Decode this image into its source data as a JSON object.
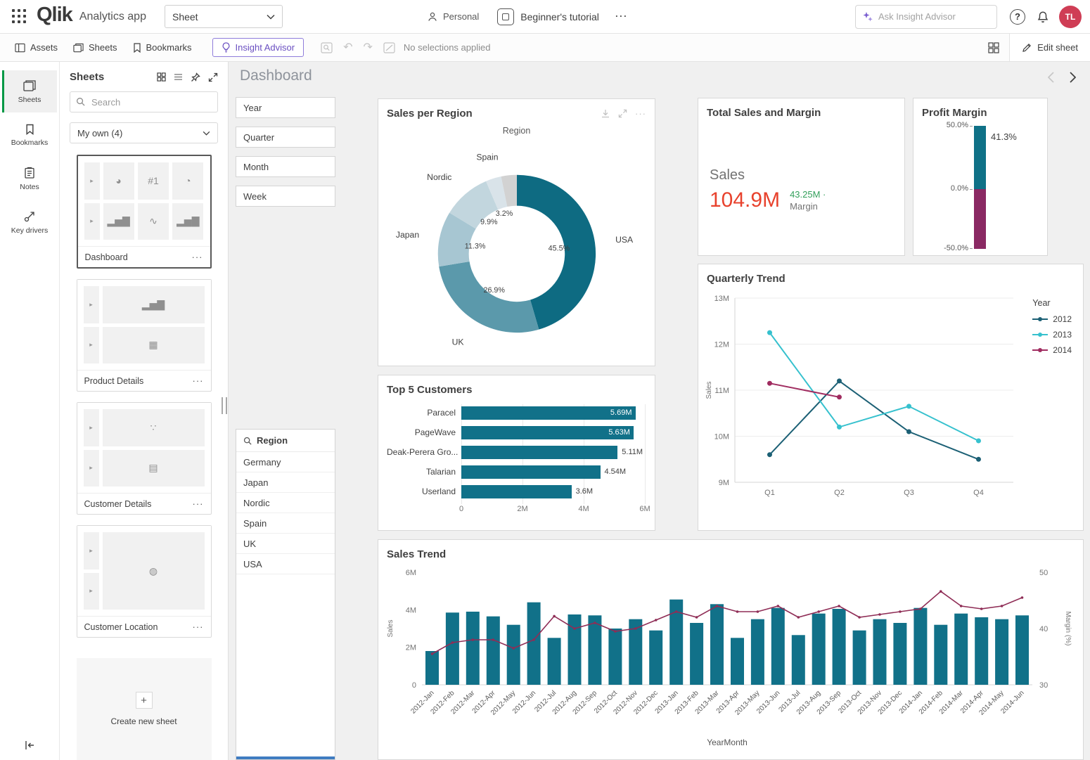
{
  "header": {
    "logo": "Qlik",
    "app_name": "Analytics app",
    "sheet_selector": "Sheet",
    "space": "Personal",
    "app_title": "Beginner's tutorial",
    "ask_placeholder": "Ask Insight Advisor",
    "avatar_initials": "TL"
  },
  "icons": {
    "more_h": "⋯",
    "more_v": "···",
    "help": "?",
    "plus": "+",
    "undo": "↶",
    "redo": "↷"
  },
  "toolbar": {
    "assets": "Assets",
    "sheets": "Sheets",
    "bookmarks": "Bookmarks",
    "insight_advisor": "Insight Advisor",
    "selections_status": "No selections applied",
    "edit_sheet": "Edit sheet"
  },
  "nav_rail": {
    "items": [
      {
        "label": "Sheets",
        "icon": "sheets",
        "active": true
      },
      {
        "label": "Bookmarks",
        "icon": "bookmark",
        "active": false
      },
      {
        "label": "Notes",
        "icon": "notes",
        "active": false
      },
      {
        "label": "Key drivers",
        "icon": "keydrivers",
        "active": false
      }
    ]
  },
  "sheets_panel": {
    "title": "Sheets",
    "search_placeholder": "Search",
    "collection": "My own (4)",
    "sheets": [
      {
        "label": "Dashboard",
        "active": true,
        "cols": 3,
        "tiles": [
          "pie",
          "rank",
          "gauge",
          "bar",
          "line",
          "bar"
        ]
      },
      {
        "label": "Product Details",
        "active": false,
        "cols": 1,
        "tiles": [
          "bar",
          "treemap"
        ]
      },
      {
        "label": "Customer Details",
        "active": false,
        "cols": 1,
        "tiles": [
          "scatter",
          "table"
        ]
      },
      {
        "label": "Customer Location",
        "active": false,
        "cols": 1,
        "tiles": [
          "globe"
        ]
      }
    ],
    "create_new": "Create new sheet"
  },
  "canvas": {
    "title": "Dashboard",
    "filters": [
      "Year",
      "Quarter",
      "Month",
      "Week"
    ],
    "region_filter": {
      "title": "Region",
      "values": [
        "Germany",
        "Japan",
        "Nordic",
        "Spain",
        "UK",
        "USA"
      ]
    }
  },
  "colors": {
    "accent_green": "#009845",
    "insight_purple": "#6a4fc1",
    "avatar_bg": "#cf3d55",
    "kpi_red": "#e8422d",
    "kpi_green": "#34a05c",
    "bar_teal": "#117189",
    "scroll_indicator_blue": "#3f7cc1"
  },
  "chart_data": [
    {
      "id": "sales_per_region",
      "type": "pie",
      "title": "Sales per Region",
      "dimension_label": "Region",
      "slices": [
        {
          "label": "USA",
          "pct": 45.5,
          "color": "#0e6b82"
        },
        {
          "label": "UK",
          "pct": 26.9,
          "color": "#5b99ab"
        },
        {
          "label": "Japan",
          "pct": 11.3,
          "color": "#a7c6d2"
        },
        {
          "label": "Nordic",
          "pct": 9.9,
          "color": "#c2d6de"
        },
        {
          "label": "Spain",
          "pct": 3.2,
          "color": "#d9e3e9"
        },
        {
          "label": "",
          "pct": 3.2,
          "color": "#d2d2d2"
        }
      ]
    },
    {
      "id": "total_sales_margin",
      "type": "kpi",
      "title": "Total Sales and Margin",
      "primary_label": "Sales",
      "primary_value": "104.9M",
      "secondary_value": "43.25M ·",
      "secondary_label": "Margin"
    },
    {
      "id": "profit_margin",
      "type": "gauge",
      "title": "Profit Margin",
      "value": "41.3%",
      "ticks": [
        "50.0%",
        "0.0%",
        "-50.0%"
      ],
      "positive_color": "#0f7187",
      "negative_color": "#8a2963"
    },
    {
      "id": "quarterly_trend",
      "type": "line",
      "title": "Quarterly Trend",
      "categories": [
        "Q1",
        "Q2",
        "Q3",
        "Q4"
      ],
      "ylabel": "Sales",
      "unit": "M",
      "ylim": [
        9,
        13
      ],
      "yticks": [
        "9M",
        "10M",
        "11M",
        "12M",
        "13M"
      ],
      "legend_title": "Year",
      "legend_position": "right",
      "series": [
        {
          "name": "2012",
          "color": "#1c6075",
          "values": [
            9.6,
            11.2,
            10.1,
            9.5
          ]
        },
        {
          "name": "2013",
          "color": "#36c1ce",
          "values": [
            12.25,
            10.2,
            10.65,
            9.9
          ]
        },
        {
          "name": "2014",
          "color": "#a02c60",
          "values": [
            11.15,
            10.85,
            null,
            null
          ]
        }
      ]
    },
    {
      "id": "top5_customers",
      "type": "bar",
      "title": "Top 5 Customers",
      "orientation": "horizontal",
      "categories": [
        "Paracel",
        "PageWave",
        "Deak-Perera Gro...",
        "Talarian",
        "Userland"
      ],
      "values": [
        5.69,
        5.63,
        5.11,
        4.54,
        3.6
      ],
      "value_labels": [
        "5.69M",
        "5.63M",
        "5.11M",
        "4.54M",
        "3.6M"
      ],
      "xticks": [
        "0",
        "2M",
        "4M",
        "6M"
      ],
      "xlim": [
        0,
        6
      ],
      "bar_color": "#117189"
    },
    {
      "id": "sales_trend",
      "type": "bar+line",
      "title": "Sales Trend",
      "xlabel": "YearMonth",
      "ylabel_left": "Sales",
      "ylabel_right": "Margin (%)",
      "yticks_left": [
        "0",
        "2M",
        "4M",
        "6M"
      ],
      "ylim_left": [
        0,
        6
      ],
      "yticks_right": [
        "30",
        "40",
        "50"
      ],
      "ylim_right": [
        30,
        50
      ],
      "bar_color": "#117189",
      "line_color": "#8f2d56",
      "categories": [
        "2012-Jan",
        "2012-Feb",
        "2012-Mar",
        "2012-Apr",
        "2012-May",
        "2012-Jun",
        "2012-Jul",
        "2012-Aug",
        "2012-Sep",
        "2012-Oct",
        "2012-Nov",
        "2012-Dec",
        "2013-Jan",
        "2013-Feb",
        "2013-Mar",
        "2013-Apr",
        "2013-May",
        "2013-Jun",
        "2013-Jul",
        "2013-Aug",
        "2013-Sep",
        "2013-Oct",
        "2013-Nov",
        "2013-Dec",
        "2014-Jan",
        "2014-Feb",
        "2014-Mar",
        "2014-Apr",
        "2014-May",
        "2014-Jun"
      ],
      "bars": [
        1.8,
        3.85,
        3.9,
        3.65,
        3.2,
        4.4,
        2.5,
        3.75,
        3.7,
        3.0,
        3.5,
        2.9,
        4.55,
        3.3,
        4.3,
        2.5,
        3.5,
        4.1,
        2.65,
        3.8,
        4.05,
        2.9,
        3.5,
        3.3,
        4.1,
        3.2,
        3.8,
        3.6,
        3.5,
        3.7
      ],
      "line": [
        35.5,
        37.5,
        38,
        38,
        36.5,
        38,
        42.2,
        40,
        41,
        39.5,
        40,
        41.5,
        43,
        42,
        44,
        43,
        43,
        44,
        42,
        43,
        44,
        42,
        42.5,
        43,
        43.5,
        46.6,
        44,
        43.5,
        44,
        45.5
      ]
    }
  ]
}
